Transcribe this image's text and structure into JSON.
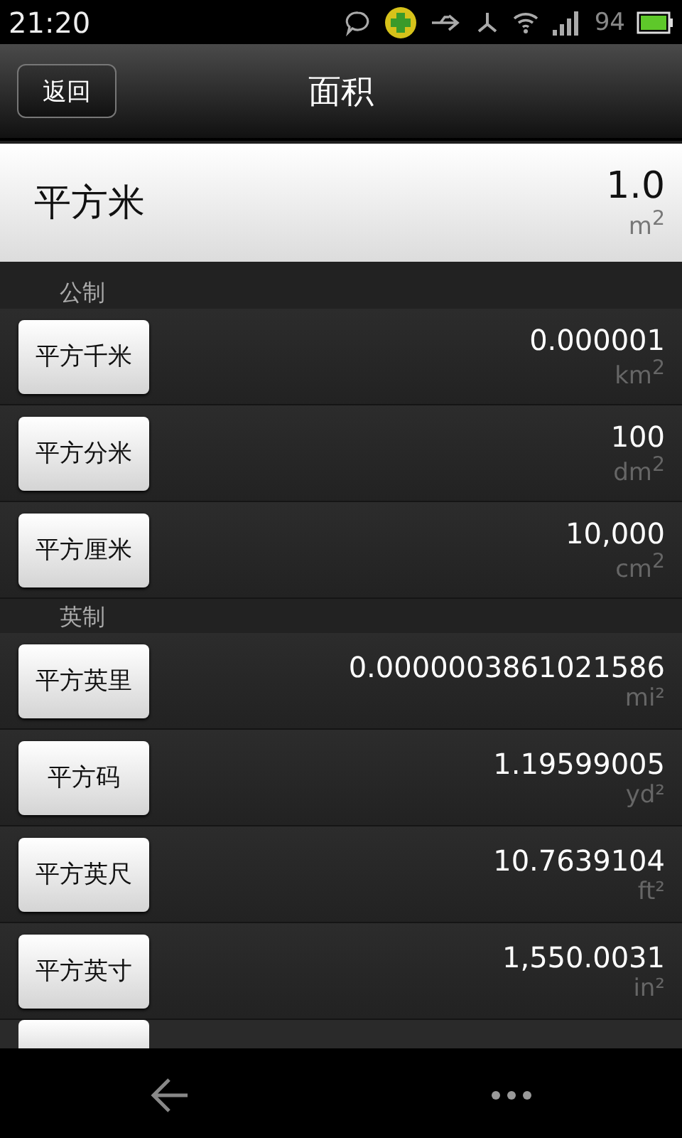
{
  "status_bar": {
    "time": "21:20",
    "battery": "94"
  },
  "title_bar": {
    "back_button": "返回",
    "title": "面积"
  },
  "base": {
    "name": "平方米",
    "value": "1.0",
    "unit": "m$^{2}$"
  },
  "sections": [
    {
      "title": "公制",
      "rows": [
        {
          "name": "平方千米",
          "value": "0.000001",
          "unit": "km$^{2}$"
        },
        {
          "name": "平方分米",
          "value": "100",
          "unit": "dm$^{2}$"
        },
        {
          "name": "平方厘米",
          "value": "10,000",
          "unit": "cm$^{2}$"
        }
      ]
    },
    {
      "title": "英制",
      "rows": [
        {
          "name": "平方英里",
          "value": "0.0000003861021586",
          "unit": "mi²"
        },
        {
          "name": "平方码",
          "value": "1.19599005",
          "unit": "yd²"
        },
        {
          "name": "平方英尺",
          "value": "10.7639104",
          "unit": "ft²"
        },
        {
          "name": "平方英寸",
          "value": "1,550.0031",
          "unit": "in²"
        }
      ]
    }
  ]
}
